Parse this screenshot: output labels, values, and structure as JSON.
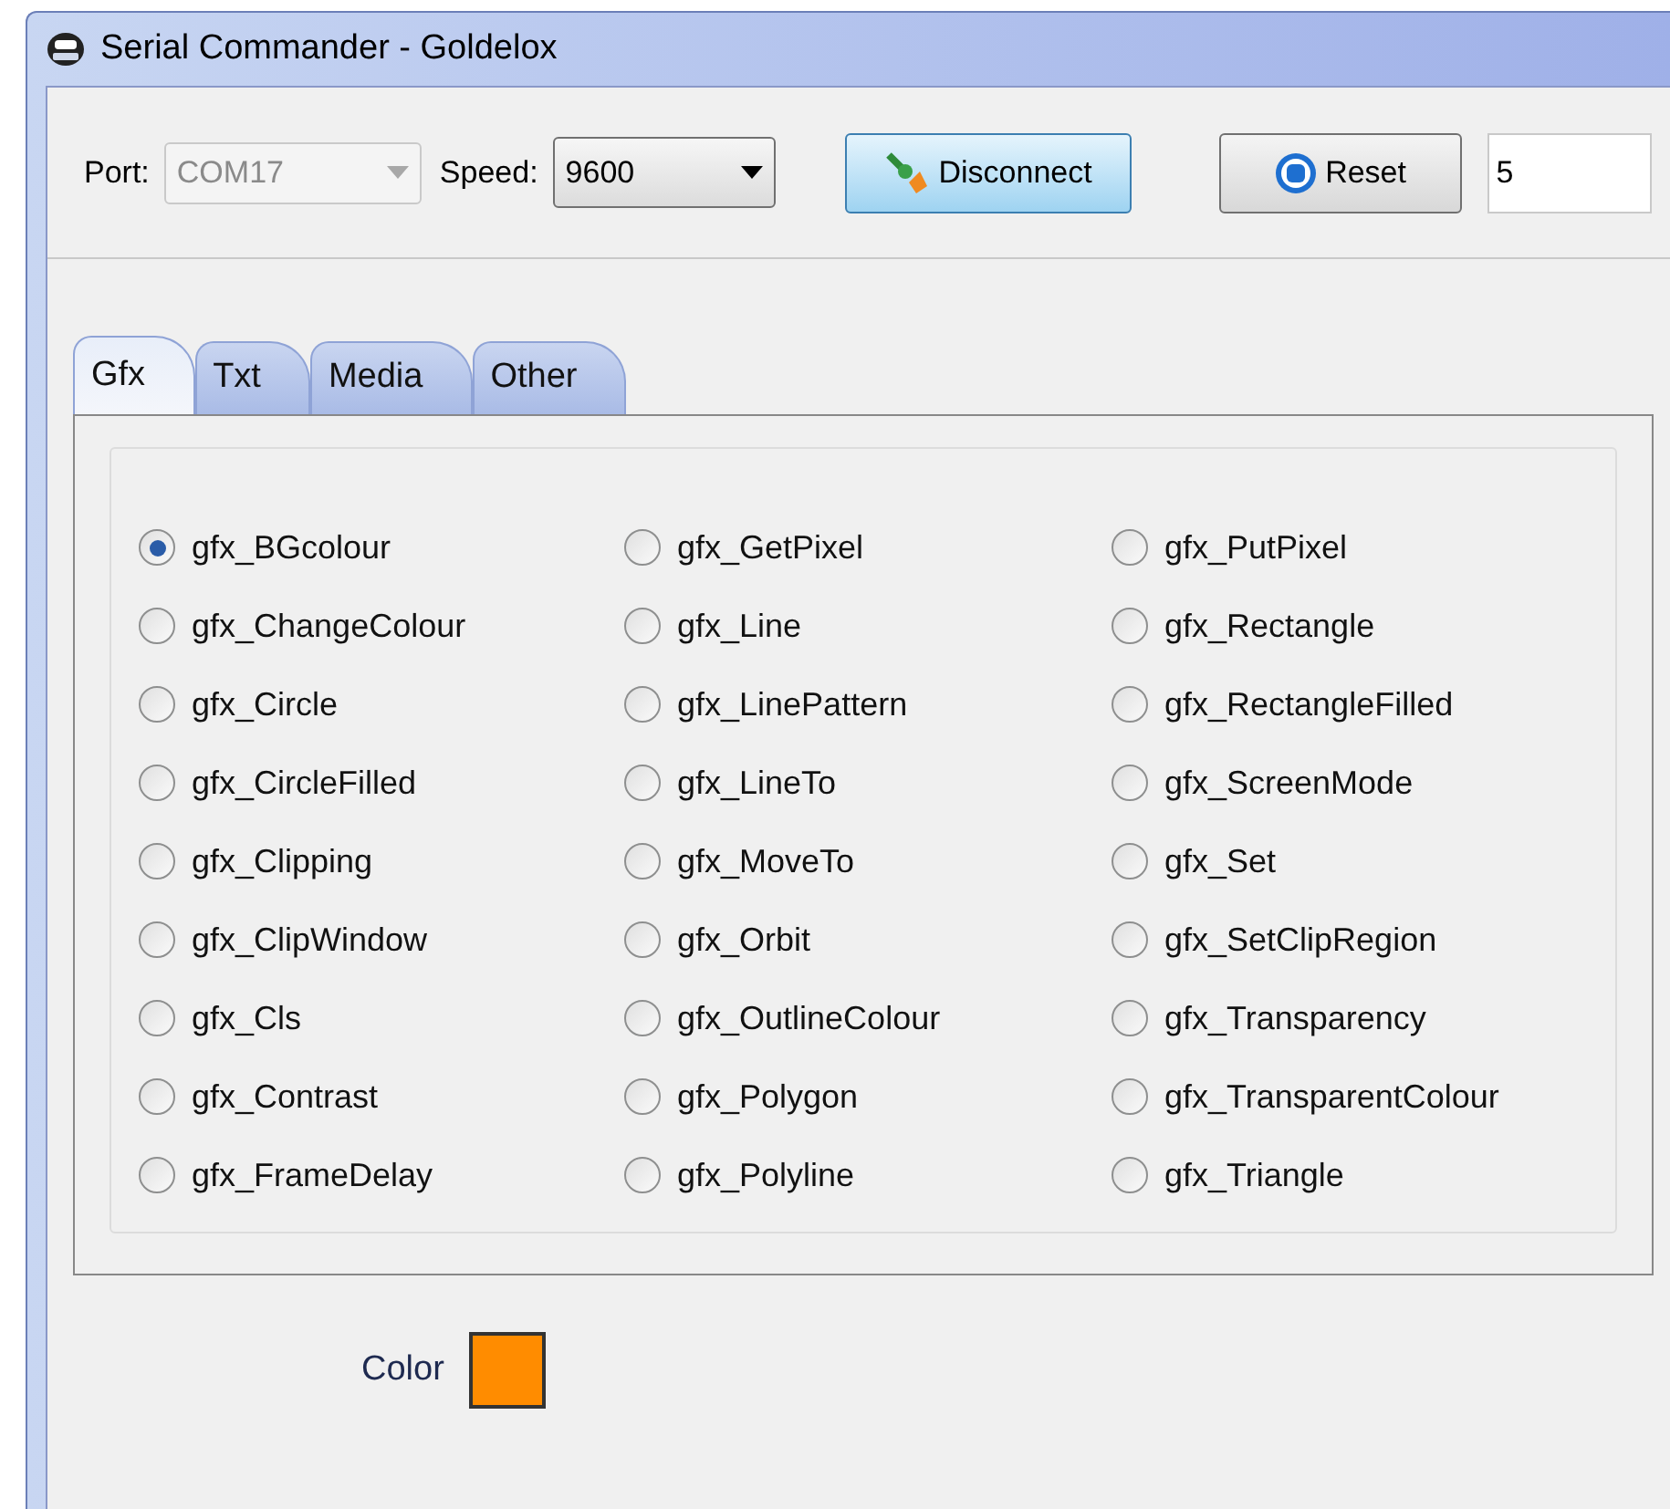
{
  "window": {
    "title": "Serial Commander - Goldelox"
  },
  "toolbar": {
    "port": {
      "label": "Port:",
      "value": "COM17",
      "disabled": true
    },
    "speed": {
      "label": "Speed:",
      "value": "9600",
      "disabled": false
    },
    "disconnect_button": "Disconnect",
    "reset_button": "Reset",
    "count_field": "5"
  },
  "tabs": [
    {
      "label": "Gfx",
      "selected": true
    },
    {
      "label": "Txt",
      "selected": false
    },
    {
      "label": "Media",
      "selected": false
    },
    {
      "label": "Other",
      "selected": false
    }
  ],
  "commands": [
    {
      "label": "gfx_BGcolour",
      "selected": true
    },
    {
      "label": "gfx_ChangeColour",
      "selected": false
    },
    {
      "label": "gfx_Circle",
      "selected": false
    },
    {
      "label": "gfx_CircleFilled",
      "selected": false
    },
    {
      "label": "gfx_Clipping",
      "selected": false
    },
    {
      "label": "gfx_ClipWindow",
      "selected": false
    },
    {
      "label": "gfx_Cls",
      "selected": false
    },
    {
      "label": "gfx_Contrast",
      "selected": false
    },
    {
      "label": "gfx_FrameDelay",
      "selected": false
    },
    {
      "label": "gfx_GetPixel",
      "selected": false
    },
    {
      "label": "gfx_Line",
      "selected": false
    },
    {
      "label": "gfx_LinePattern",
      "selected": false
    },
    {
      "label": "gfx_LineTo",
      "selected": false
    },
    {
      "label": "gfx_MoveTo",
      "selected": false
    },
    {
      "label": "gfx_Orbit",
      "selected": false
    },
    {
      "label": "gfx_OutlineColour",
      "selected": false
    },
    {
      "label": "gfx_Polygon",
      "selected": false
    },
    {
      "label": "gfx_Polyline",
      "selected": false
    },
    {
      "label": "gfx_PutPixel",
      "selected": false
    },
    {
      "label": "gfx_Rectangle",
      "selected": false
    },
    {
      "label": "gfx_RectangleFilled",
      "selected": false
    },
    {
      "label": "gfx_ScreenMode",
      "selected": false
    },
    {
      "label": "gfx_Set",
      "selected": false
    },
    {
      "label": "gfx_SetClipRegion",
      "selected": false
    },
    {
      "label": "gfx_Transparency",
      "selected": false
    },
    {
      "label": "gfx_TransparentColour",
      "selected": false
    },
    {
      "label": "gfx_Triangle",
      "selected": false
    }
  ],
  "color_picker": {
    "label": "Color",
    "color": "#ff8c00"
  }
}
